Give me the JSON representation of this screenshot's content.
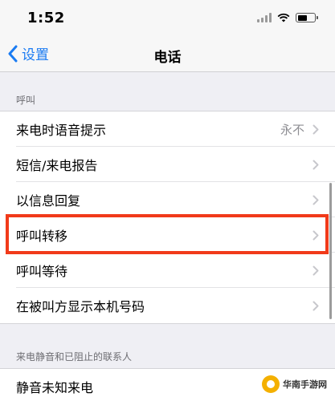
{
  "status_bar": {
    "time": "1:52"
  },
  "nav": {
    "back_label": "设置",
    "title": "电话"
  },
  "sections": [
    {
      "header": "呼叫",
      "items": [
        {
          "label": "来电时语音提示",
          "value": "永不"
        },
        {
          "label": "短信/来电报告"
        },
        {
          "label": "以信息回复"
        },
        {
          "label": "呼叫转移",
          "highlighted": true
        },
        {
          "label": "呼叫等待"
        },
        {
          "label": "在被叫方显示本机号码"
        }
      ]
    },
    {
      "header": "来电静音和已阻止的联系人",
      "items": [
        {
          "label": "静音未知来电"
        }
      ]
    }
  ],
  "watermark": {
    "text": "华南手游网"
  },
  "colors": {
    "accent": "#1a7bf2",
    "highlight": "#f13a1a",
    "background": "#efeff4"
  }
}
